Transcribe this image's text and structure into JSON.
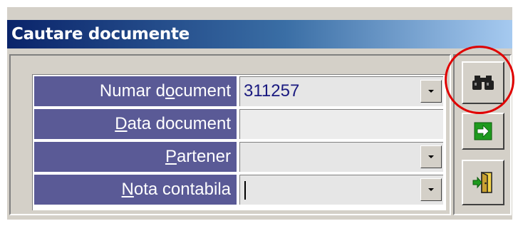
{
  "window": {
    "title": "Cautare documente"
  },
  "form": {
    "rows": [
      {
        "label_pre": "Numar d",
        "label_key": "o",
        "label_post": "cument",
        "value": "311257",
        "has_dropdown": true,
        "readonly": false
      },
      {
        "label_pre": "",
        "label_key": "D",
        "label_post": "ata document",
        "value": "",
        "has_dropdown": false,
        "readonly": true
      },
      {
        "label_pre": "",
        "label_key": "P",
        "label_post": "artener",
        "value": "",
        "has_dropdown": true,
        "readonly": false
      },
      {
        "label_pre": "",
        "label_key": "N",
        "label_post": "ota contabila",
        "value": "",
        "has_dropdown": true,
        "readonly": false,
        "has_cursor": true
      }
    ]
  },
  "toolbar": {
    "buttons": [
      {
        "icon": "binoculars-icon",
        "highlighted": true
      },
      {
        "icon": "green-arrow-right-icon",
        "highlighted": false
      },
      {
        "icon": "exit-door-icon",
        "highlighted": false
      }
    ]
  },
  "colors": {
    "title_gradient_start": "#0a246a",
    "title_gradient_end": "#a6caf0",
    "label_bg": "#5a5a96",
    "field_text": "#1a1a80",
    "highlight_ring": "#e00000"
  }
}
